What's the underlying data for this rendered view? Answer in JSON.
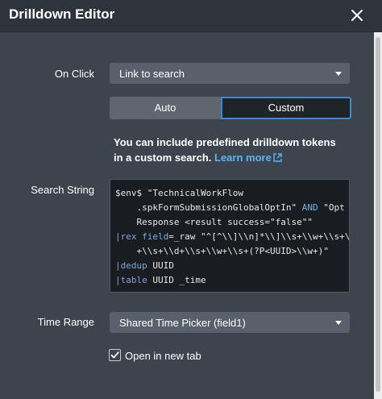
{
  "header": {
    "title": "Drilldown Editor"
  },
  "on_click": {
    "label": "On Click",
    "selected": "Link to search"
  },
  "mode": {
    "auto_label": "Auto",
    "custom_label": "Custom",
    "active": "Custom"
  },
  "info": {
    "text": "You can include predefined drilldown tokens in a custom search.",
    "link": "Learn more"
  },
  "search_string": {
    "label": "Search String",
    "lines": [
      {
        "parts": [
          [
            "plain",
            "$env$ \"TechnicalWorkFlow"
          ]
        ]
      },
      {
        "parts": [
          [
            "plain",
            "    .spkFormSubmissionGlobalOptIn\" "
          ],
          [
            "kw",
            "AND"
          ],
          [
            "plain",
            " \"Opt In"
          ]
        ]
      },
      {
        "parts": [
          [
            "plain",
            "    Response <result success=\"false\"\""
          ]
        ]
      },
      {
        "parts": [
          [
            "pipe",
            "|"
          ],
          [
            "cmd",
            "rex"
          ],
          [
            "plain",
            " "
          ],
          [
            "kw",
            "field"
          ],
          [
            "plain",
            "=_raw \"^[^\\\\]\\\\n]*\\\\]\\\\s+\\\\w+\\\\s+\\\\w"
          ]
        ]
      },
      {
        "parts": [
          [
            "plain",
            "    +\\\\s+\\\\d+\\\\s+\\\\w+\\\\s+(?P<UUID>\\\\w+)\""
          ]
        ]
      },
      {
        "parts": [
          [
            "pipe",
            "|"
          ],
          [
            "cmd",
            "dedup"
          ],
          [
            "plain",
            " UUID"
          ]
        ]
      },
      {
        "parts": [
          [
            "pipe",
            "|"
          ],
          [
            "cmd",
            "table"
          ],
          [
            "plain",
            " UUID _time"
          ]
        ]
      }
    ]
  },
  "time_range": {
    "label": "Time Range",
    "selected": "Shared Time Picker (field1)"
  },
  "open_new_tab": {
    "label": "Open in new tab",
    "checked": true
  },
  "colors": {
    "accent": "#3c8ad6",
    "link": "#5cb4f5",
    "background": "#3c444d"
  },
  "icons": [
    "close-icon",
    "chevron-down-icon",
    "external-link-icon",
    "checkmark-icon"
  ]
}
